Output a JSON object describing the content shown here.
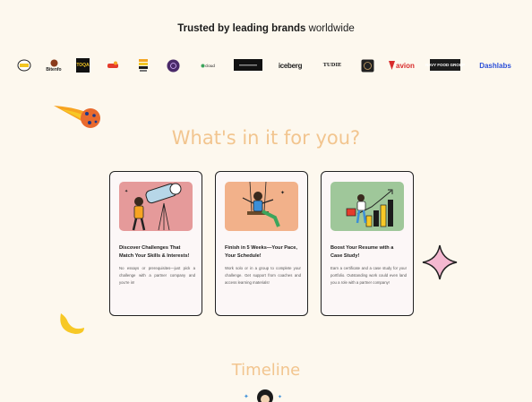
{
  "trusted": {
    "bold": "Trusted by leading brands",
    "rest": " worldwide"
  },
  "logos": [
    {
      "label": "",
      "icon": "badge-logo-icon"
    },
    {
      "label": "Bitenfo",
      "icon": "bitenfo-logo-icon"
    },
    {
      "label": "TOQA",
      "icon": "toqa-logo-icon"
    },
    {
      "label": "",
      "icon": "red-brand-logo-icon"
    },
    {
      "label": "",
      "icon": "striped-logo-icon"
    },
    {
      "label": "",
      "icon": "purple-circle-logo-icon"
    },
    {
      "label": "cloud",
      "icon": "cloud-logo-icon"
    },
    {
      "label": "",
      "icon": "dark-box-logo-icon"
    },
    {
      "label": "iceberg",
      "icon": "iceberg-logo-icon"
    },
    {
      "label": "TUDIE",
      "icon": "tudie-logo-icon"
    },
    {
      "label": "",
      "icon": "round-dark-logo-icon"
    },
    {
      "label": "avion",
      "icon": "avion-logo-icon"
    },
    {
      "label": "NAVY FOOD GROUP",
      "icon": "navy-food-logo-icon"
    },
    {
      "label": "Dashlabs",
      "icon": "dashlabs-logo-icon"
    }
  ],
  "section": {
    "heading": "What's in it for you?"
  },
  "cards": [
    {
      "title": "Discover Challenges That Match Your Skills & Interests!",
      "desc": "No essays or prerequisites—just pick a challenge with a partner company and you're in!",
      "color": "#e59a9a"
    },
    {
      "title": "Finish in 5 Weeks—Your Pace, Your Schedule!",
      "desc": "Work solo or in a group to complete your challenge. Get support from coaches and access learning materials!",
      "color": "#f2b18a"
    },
    {
      "title": "Boost Your Resume with a Case Study!",
      "desc": "Earn a certificate and a case study for your portfolio. Outstanding work could even land you a role with a partner company!",
      "color": "#9fc79a"
    }
  ],
  "timeline": {
    "heading": "Timeline"
  },
  "colors": {
    "accent": "#f2c58f",
    "background": "#fdf8ee",
    "star": "#f4b8d0",
    "moon": "#f7c826"
  }
}
